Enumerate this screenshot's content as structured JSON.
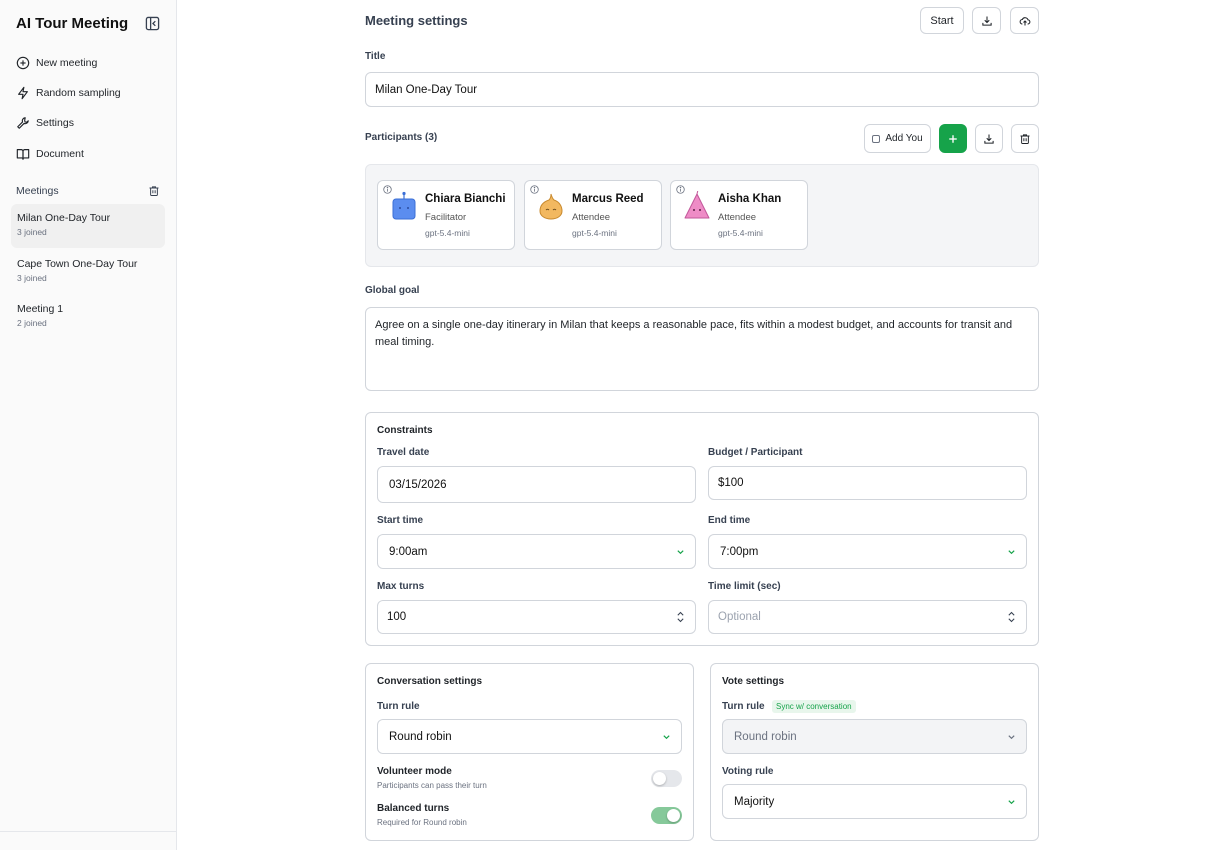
{
  "sidebar": {
    "app_title": "AI Tour Meeting",
    "nav": [
      {
        "label": "New meeting",
        "icon": "plus-circle-icon"
      },
      {
        "label": "Random sampling",
        "icon": "lightning-icon"
      },
      {
        "label": "Settings",
        "icon": "wrench-icon"
      },
      {
        "label": "Document",
        "icon": "book-icon"
      }
    ],
    "meetings_header": "Meetings",
    "meetings": [
      {
        "name": "Milan One-Day Tour",
        "joined": "3 joined",
        "active": true
      },
      {
        "name": "Cape Town One-Day Tour",
        "joined": "3 joined"
      },
      {
        "name": "Meeting 1",
        "joined": "2 joined"
      }
    ]
  },
  "main": {
    "heading": "Meeting settings",
    "start_label": "Start",
    "title_label": "Title",
    "title_value": "Milan One-Day Tour",
    "participants_label": "Participants (3)",
    "add_you_label": "Add You",
    "participants": [
      {
        "name": "Chiara Bianchi",
        "role": "Facilitator",
        "model": "gpt-5.4-mini",
        "color": "#5b8def"
      },
      {
        "name": "Marcus Reed",
        "role": "Attendee",
        "model": "gpt-5.4-mini",
        "color": "#f2b860"
      },
      {
        "name": "Aisha Khan",
        "role": "Attendee",
        "model": "gpt-5.4-mini",
        "color": "#ee8cc6"
      }
    ],
    "global_goal_label": "Global goal",
    "global_goal_value": "Agree on a single one-day itinerary in Milan that keeps a reasonable pace, fits within a modest budget, and accounts for transit and meal timing.",
    "constraints": {
      "title": "Constraints",
      "travel_date_label": "Travel date",
      "travel_date_value": "03/15/2026",
      "budget_label": "Budget / Participant",
      "budget_value": "$100",
      "start_time_label": "Start time",
      "start_time_value": "9:00am",
      "end_time_label": "End time",
      "end_time_value": "7:00pm",
      "max_turns_label": "Max turns",
      "max_turns_value": "100",
      "time_limit_label": "Time limit (sec)",
      "time_limit_placeholder": "Optional"
    },
    "conversation": {
      "title": "Conversation settings",
      "turn_rule_label": "Turn rule",
      "turn_rule_value": "Round robin",
      "volunteer_label": "Volunteer mode",
      "volunteer_sub": "Participants can pass their turn",
      "volunteer_on": false,
      "balanced_label": "Balanced turns",
      "balanced_sub": "Required for Round robin",
      "balanced_on": true
    },
    "vote": {
      "title": "Vote settings",
      "turn_rule_label": "Turn rule",
      "sync_badge": "Sync w/ conversation",
      "turn_rule_value": "Round robin",
      "voting_rule_label": "Voting rule",
      "voting_rule_value": "Majority"
    }
  },
  "colors": {
    "accent_green": "#16a34a",
    "toggle_on": "#86c99a"
  }
}
